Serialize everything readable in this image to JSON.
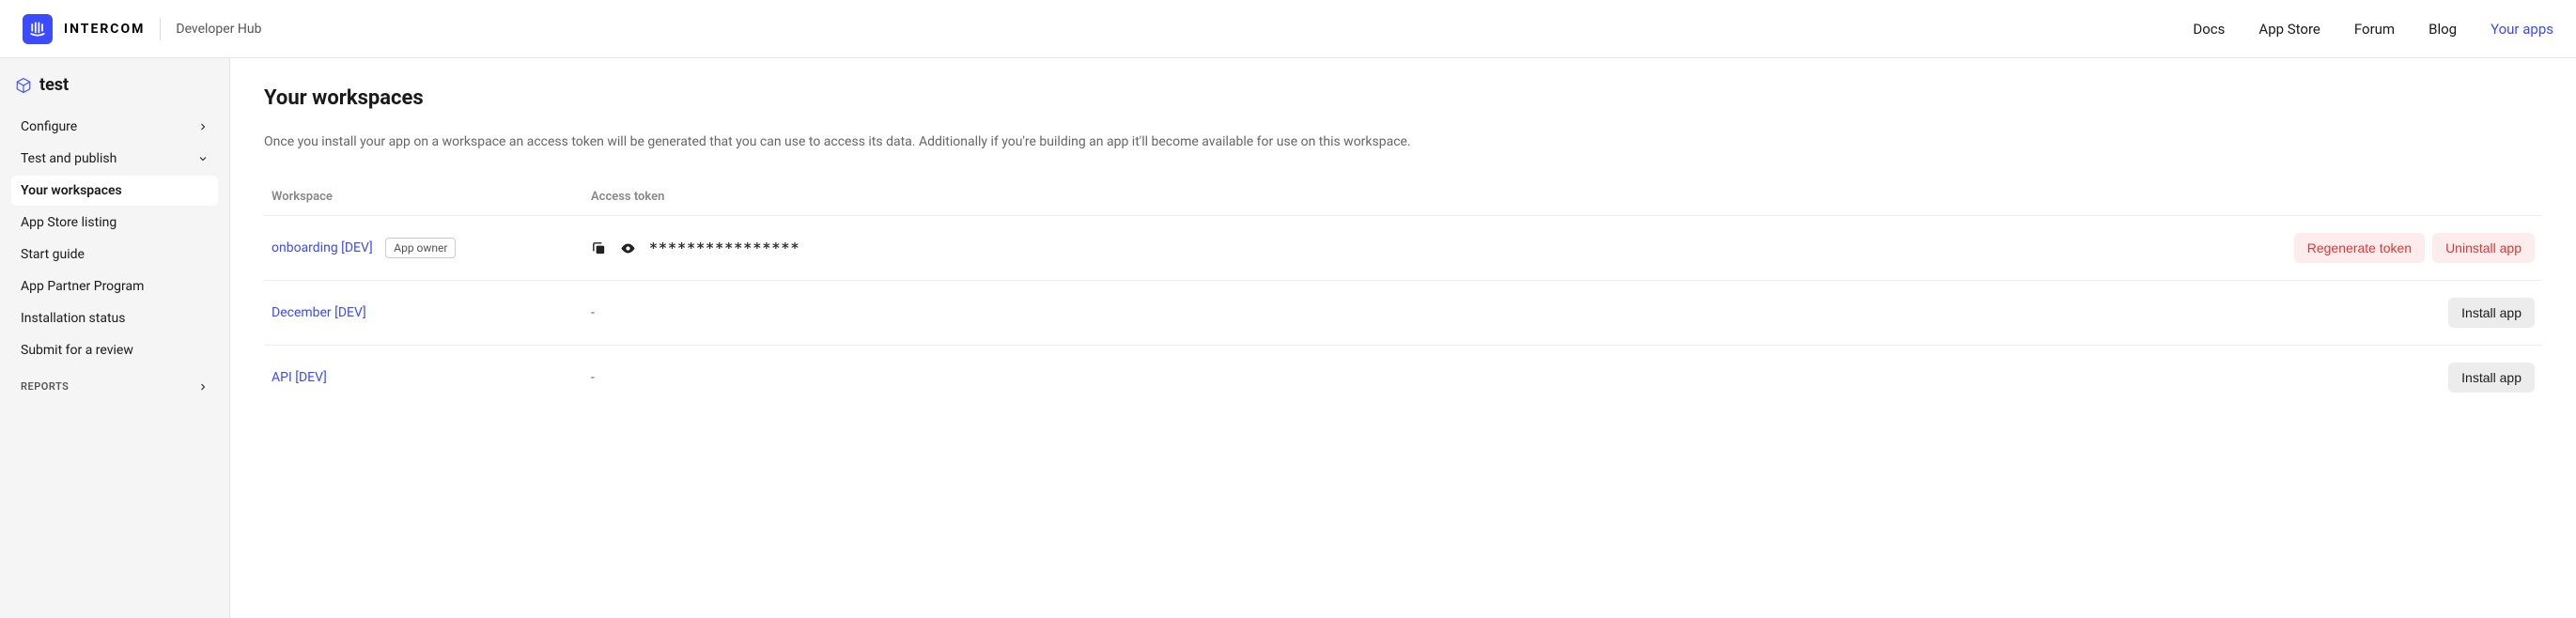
{
  "header": {
    "brand": "INTERCOM",
    "subtitle": "Developer Hub",
    "nav": [
      {
        "label": "Docs",
        "active": false
      },
      {
        "label": "App Store",
        "active": false
      },
      {
        "label": "Forum",
        "active": false
      },
      {
        "label": "Blog",
        "active": false
      },
      {
        "label": "Your apps",
        "active": true
      }
    ]
  },
  "sidebar": {
    "app_name": "test",
    "items": [
      {
        "label": "Configure",
        "chevron": "right"
      },
      {
        "label": "Test and publish",
        "chevron": "down"
      },
      {
        "label": "Your workspaces",
        "active": true
      },
      {
        "label": "App Store listing"
      },
      {
        "label": "Start guide"
      },
      {
        "label": "App Partner Program"
      },
      {
        "label": "Installation status"
      },
      {
        "label": "Submit for a review"
      }
    ],
    "section_header": "REPORTS"
  },
  "main": {
    "title": "Your workspaces",
    "description": "Once you install your app on a workspace an access token will be generated that you can use to access its data. Additionally if you're building an app it'll become available for use on this workspace.",
    "columns": {
      "workspace": "Workspace",
      "access_token": "Access token"
    },
    "rows": [
      {
        "name": "onboarding [DEV]",
        "badge": "App owner",
        "token_masked": "****************",
        "has_token": true,
        "actions": [
          {
            "label": "Regenerate token",
            "style": "danger"
          },
          {
            "label": "Uninstall app",
            "style": "danger"
          }
        ]
      },
      {
        "name": "December [DEV]",
        "has_token": false,
        "token_placeholder": "-",
        "actions": [
          {
            "label": "Install app",
            "style": "gray"
          }
        ]
      },
      {
        "name": "API [DEV]",
        "has_token": false,
        "token_placeholder": "-",
        "actions": [
          {
            "label": "Install app",
            "style": "gray"
          }
        ]
      }
    ]
  }
}
